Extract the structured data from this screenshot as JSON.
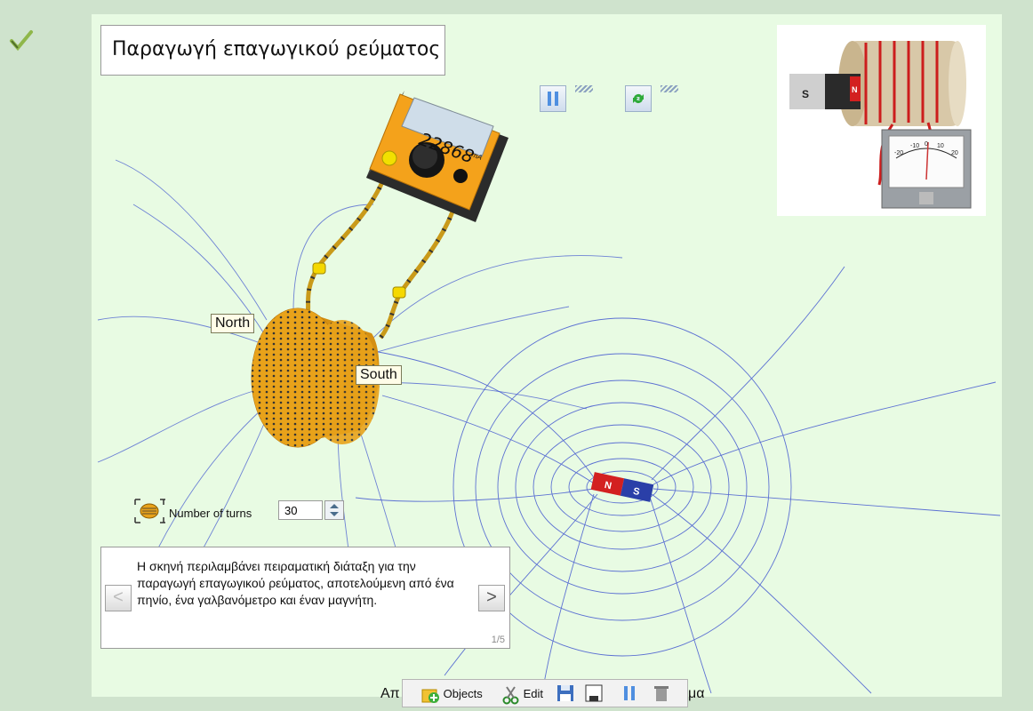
{
  "title": "Παραγωγή επαγωγικού ρεύματος",
  "meter": {
    "reading": "22868",
    "unit": "mA"
  },
  "labels": {
    "north": "North",
    "south": "South"
  },
  "magnet": {
    "n": "N",
    "s": "S"
  },
  "thumbnail": {
    "magnet_s": "S",
    "magnet_n": "N",
    "scale": [
      "-20",
      "-10",
      "0",
      "10",
      "20"
    ]
  },
  "turns": {
    "label": "Number of turns",
    "value": "30"
  },
  "info": {
    "text": "Η σκηνή περιλαμβάνει πειραματική διάταξη για την παραγωγή επαγωγικού ρεύματος, αποτελούμενη από ένα πηνίο, ένα γαλβανόμετρο και έναν μαγνήτη.",
    "prev": "<",
    "next": ">",
    "page": "1/5"
  },
  "caption": {
    "left": "Απ",
    "right": "μα"
  },
  "toolbar": {
    "objects": "Objects",
    "edit": "Edit"
  },
  "colors": {
    "stage": "#e8fbe3",
    "coil": "#e8a21a",
    "field_lines": "#3a4fcf",
    "magnet_n": "#d32020",
    "magnet_s": "#2a3fa8"
  }
}
